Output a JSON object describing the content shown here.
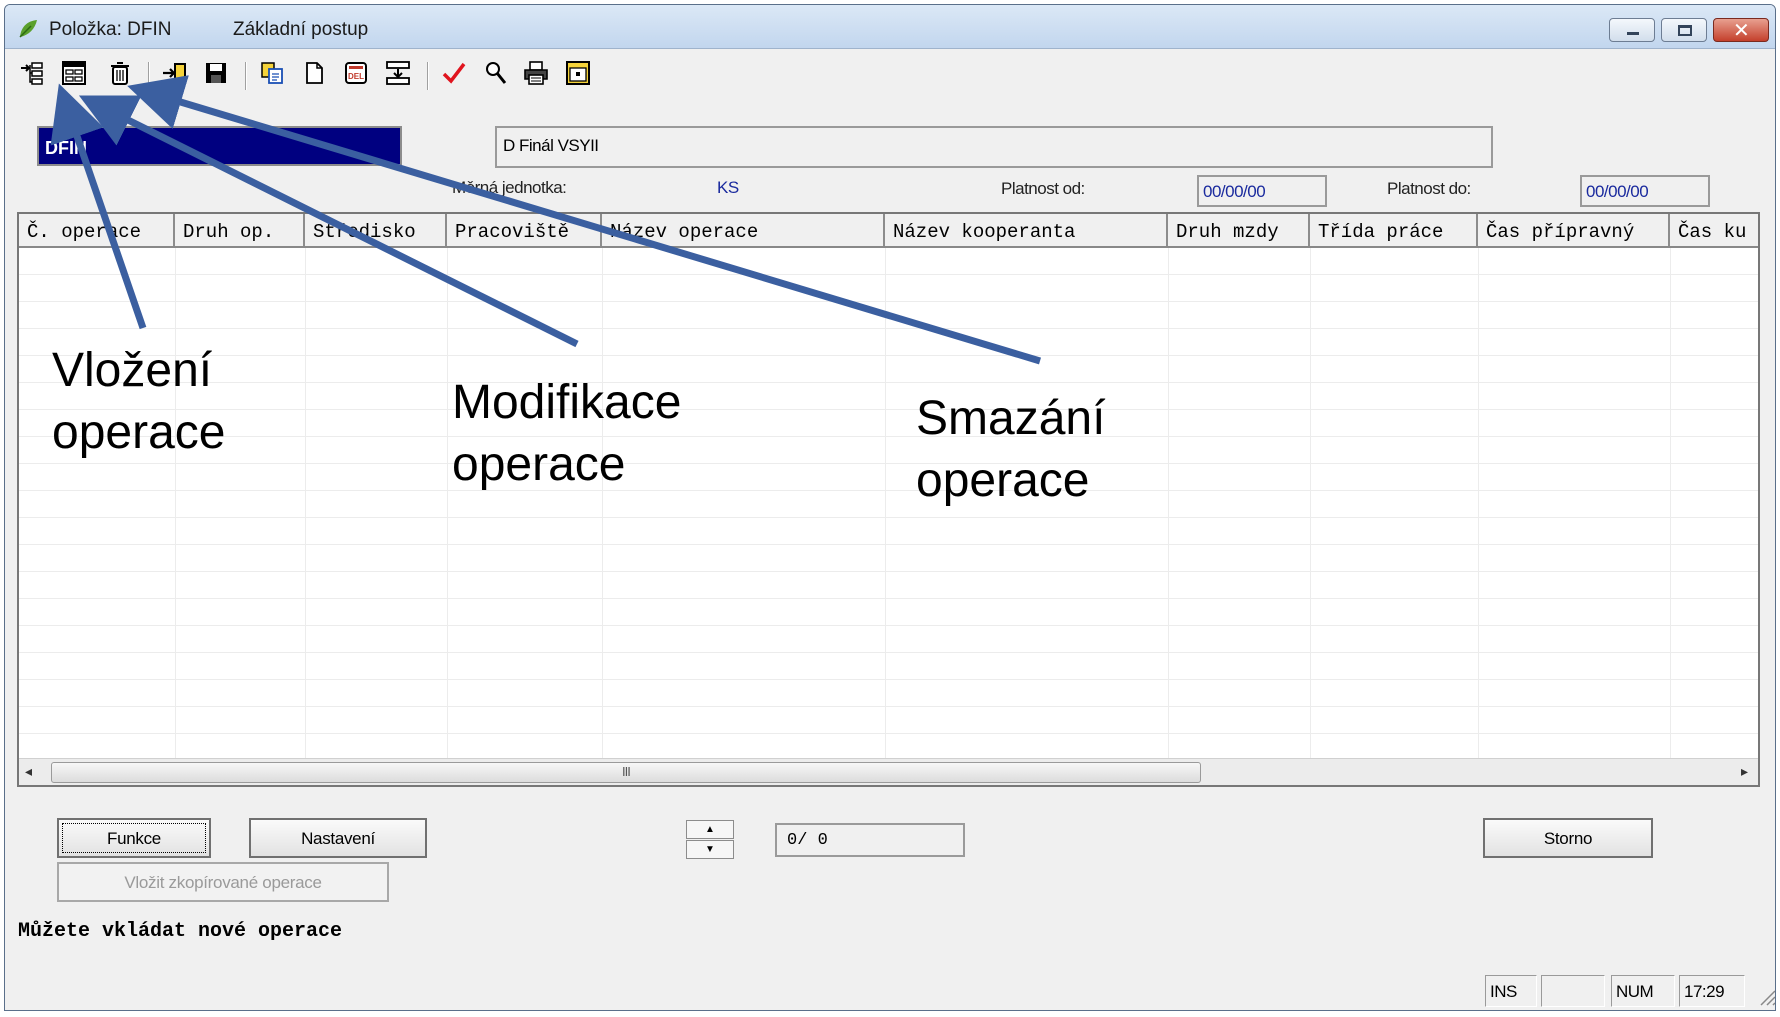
{
  "window": {
    "title_item": "Položka: DFIN",
    "title_sub": "Základní postup"
  },
  "toolbar": {
    "icons": [
      "insert-row-icon",
      "modify-form-icon",
      "trash-icon",
      "import-icon",
      "save-icon",
      "copy-icon",
      "new-document-icon",
      "del-icon",
      "tree-icon",
      "checkmark-icon",
      "find-icon",
      "print-icon",
      "window-icon"
    ]
  },
  "form": {
    "code": "DFIN",
    "name": "D Finál VSYII",
    "unit_label": "Měrná jednotka:",
    "unit_value": "KS",
    "valid_from_label": "Platnost od:",
    "valid_from": "00/00/00",
    "valid_to_label": "Platnost do:",
    "valid_to": "00/00/00"
  },
  "grid": {
    "columns": [
      "Č. operace",
      "Druh op.",
      "Středisko",
      "Pracoviště",
      "Název operace",
      "Název kooperanta",
      "Druh mzdy",
      "Třída práce",
      "Čas přípravný",
      "Čas ku"
    ],
    "scroll_grip": "III"
  },
  "buttons": {
    "funkce": "Funkce",
    "nastaveni": "Nastavení",
    "vlozit": "Vložit zkopírované operace",
    "storno": "Storno"
  },
  "counter": "0/     0",
  "status_message": "Můžete vkládat nové operace",
  "statusbar": {
    "ins": "INS",
    "empty": "",
    "num": "NUM",
    "time": "17:29"
  },
  "annotations": {
    "insert_line1": "Vložení",
    "insert_line2": "operace",
    "modify_line1": "Modifikace",
    "modify_line2": "operace",
    "delete_line1": "Smazání",
    "delete_line2": "operace"
  },
  "colors": {
    "selection": "#000080",
    "arrow": "#3b5fa0",
    "field_text": "#1a2a9e"
  }
}
